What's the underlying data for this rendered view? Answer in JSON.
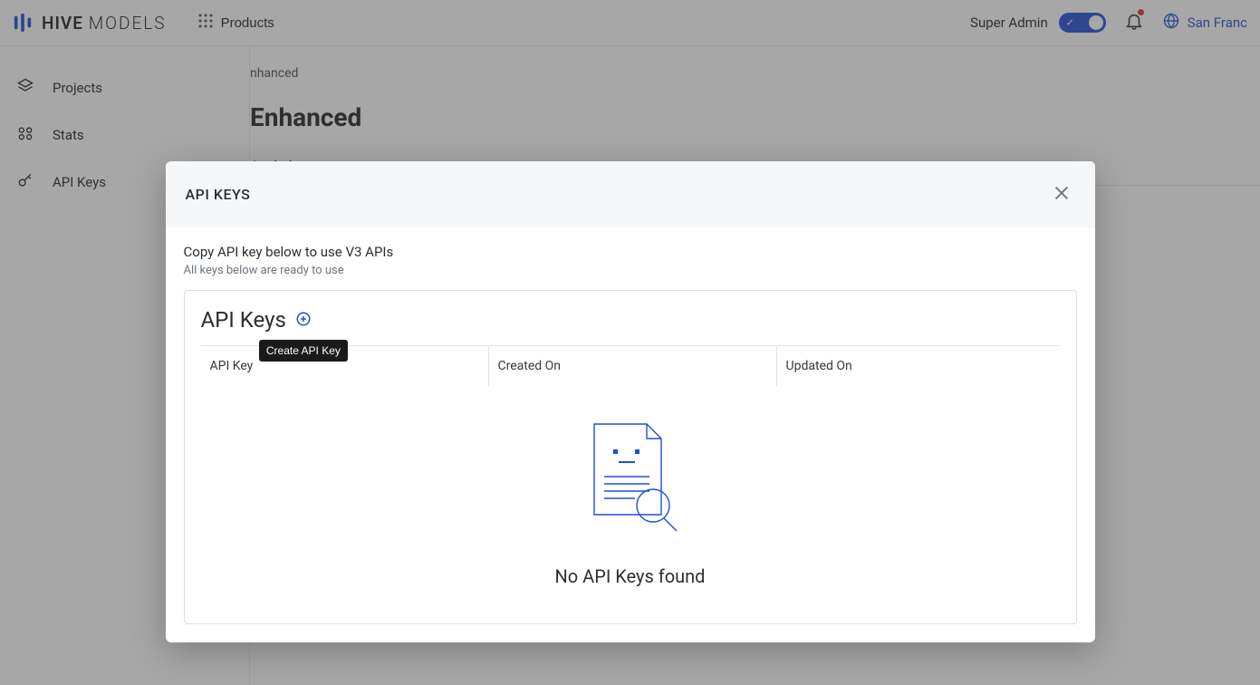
{
  "header": {
    "brand_bold": "HIVE",
    "brand_light": "MODELS",
    "products_label": "Products",
    "super_admin_label": "Super Admin",
    "region_label": "San Franc"
  },
  "sidebar": {
    "items": [
      {
        "label": "Projects"
      },
      {
        "label": "Stats"
      },
      {
        "label": "API Keys"
      }
    ]
  },
  "page": {
    "breadcrumb_tail": "nhanced",
    "title": "Enhanced",
    "tab_analytics": "Analytics"
  },
  "modal": {
    "title": "API KEYS",
    "copy_line": "Copy API key below to use V3 APIs",
    "sub_line": "All keys below are ready to use",
    "card_title": "API Keys",
    "tooltip_create": "Create API Key",
    "columns": {
      "api_key": "API Key",
      "created_on": "Created On",
      "updated_on": "Updated On"
    },
    "empty_message": "No API Keys found"
  }
}
